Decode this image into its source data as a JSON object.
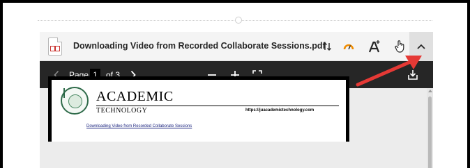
{
  "viewer": {
    "file_title": "Downloading Video from Recorded Collaborate Sessions.pdf",
    "icons": {
      "file": "pdf-file-icon",
      "sort": "sort-arrows-icon",
      "gauge": "gauge-icon",
      "text_tool": "text-add-icon",
      "hand": "hand-pointer-icon",
      "collapse": "chevron-up-icon"
    }
  },
  "toolbar": {
    "page_label": "Page",
    "current_page": "1",
    "page_total": "of 3",
    "icons": {
      "prev": "chevron-left-icon",
      "next": "chevron-right-icon",
      "zoom_out": "minus-icon",
      "zoom_in": "plus-icon",
      "fit": "fit-screen-icon",
      "download": "download-icon"
    }
  },
  "document": {
    "brand_main": "ACADEMIC",
    "brand_sub": "TECHNOLOGY",
    "url": "https://juacademictechnology.com",
    "heading": "Downloading Video from Recorded Collaborate Sessions"
  },
  "colors": {
    "toolbar_bg": "#262626",
    "accent_arrow": "#e53935",
    "gauge": "#f08c00"
  }
}
